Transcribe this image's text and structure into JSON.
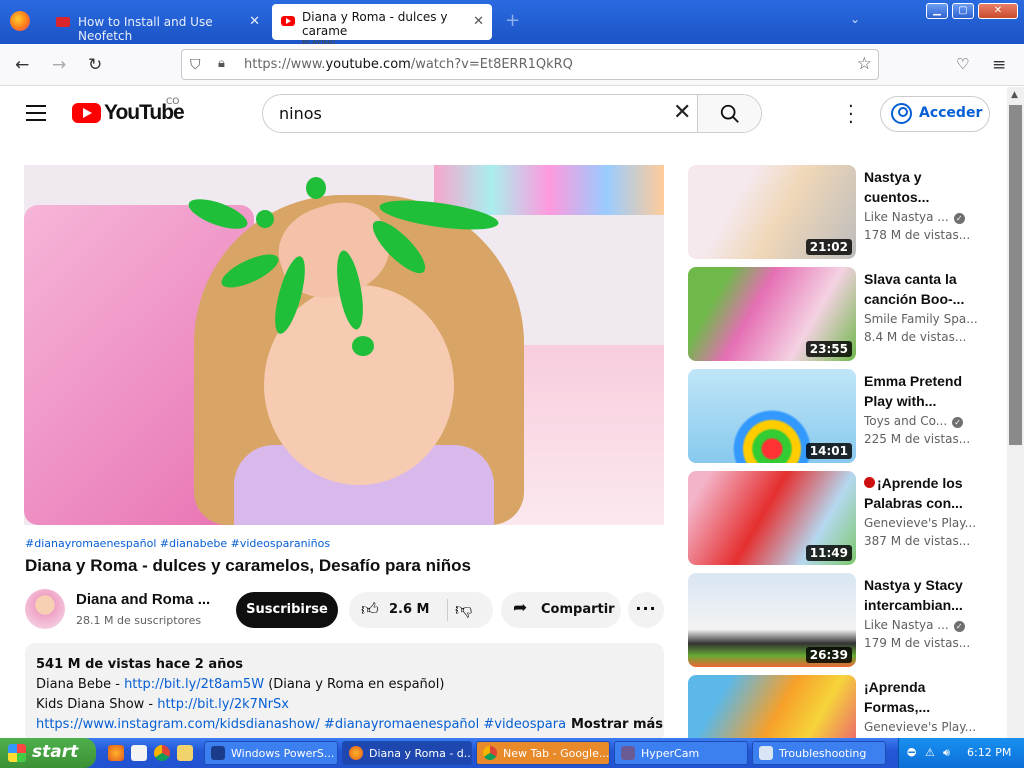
{
  "browser": {
    "tabs": [
      {
        "title": "How to Install and Use Neofetch",
        "close": "✕"
      },
      {
        "title": "Diana y Roma - dulces y carame",
        "status": "PLAYING",
        "close": "✕"
      }
    ],
    "new_tab": "+",
    "url": "https://www.youtube.com/watch?v=Et8ERR1QkRQ",
    "url_domain": "youtube.com"
  },
  "youtube": {
    "logo_text": "YouTube",
    "country_code": "CO",
    "search_query": "ninos",
    "signin_label": "Acceder",
    "accent": "#065fd4",
    "brand": "#ff0000"
  },
  "video": {
    "hashtags": "#dianayromaenespañol #dianabebe #videosparaniños",
    "title": "Diana y Roma - dulces y caramelos, Desafío para niños",
    "channel": "Diana and Roma ...",
    "subscribers": "28.1 M de suscriptores",
    "subscribe_label": "Suscribirse",
    "likes": "2.6 M",
    "share_label": "Compartir",
    "description": {
      "stats": "541 M de vistas  hace 2 años",
      "line1_prefix": "Diana Bebe - ",
      "line1_link": "http://bit.ly/2t8am5W",
      "line1_suffix": " (Diana y Roma en español)",
      "line2_prefix": "Kids Diana Show - ",
      "line2_link": "http://bit.ly/2k7NrSx",
      "line3_link": "https://www.instagram.com/kidsdianashow/ #dianayromaenespañol #videosparaniñ",
      "show_more": "Mostrar más"
    }
  },
  "recommendations": [
    {
      "title": "Nastya y cuentos...",
      "channel": "Like Nastya ...",
      "verified": true,
      "views": "178 M de vistas...",
      "duration": "21:02"
    },
    {
      "title": "Slava canta la canción Boo-...",
      "channel": "Smile Family Spa...",
      "verified": false,
      "views": "8.4 M de vistas...",
      "duration": "23:55"
    },
    {
      "title": "Emma Pretend Play with...",
      "channel": "Toys and Co...",
      "verified": true,
      "views": "225 M de vistas...",
      "duration": "14:01"
    },
    {
      "title": "¡Aprende los Palabras con...",
      "channel": "Genevieve's Play...",
      "verified": false,
      "views": "387 M de vistas...",
      "duration": "11:49",
      "live_dot": true
    },
    {
      "title": "Nastya y Stacy intercambian...",
      "channel": "Like Nastya ...",
      "verified": true,
      "views": "179 M de vistas...",
      "duration": "26:39"
    },
    {
      "title": "¡Aprenda Formas,...",
      "channel": "Genevieve's Play...",
      "verified": false,
      "views": "",
      "duration": ""
    }
  ],
  "taskbar": {
    "start_label": "start",
    "tasks": [
      "Windows PowerS...",
      "Diana y Roma - d...",
      "New Tab - Google...",
      "HyperCam",
      "Troubleshooting"
    ],
    "clock": "6:12 PM"
  }
}
